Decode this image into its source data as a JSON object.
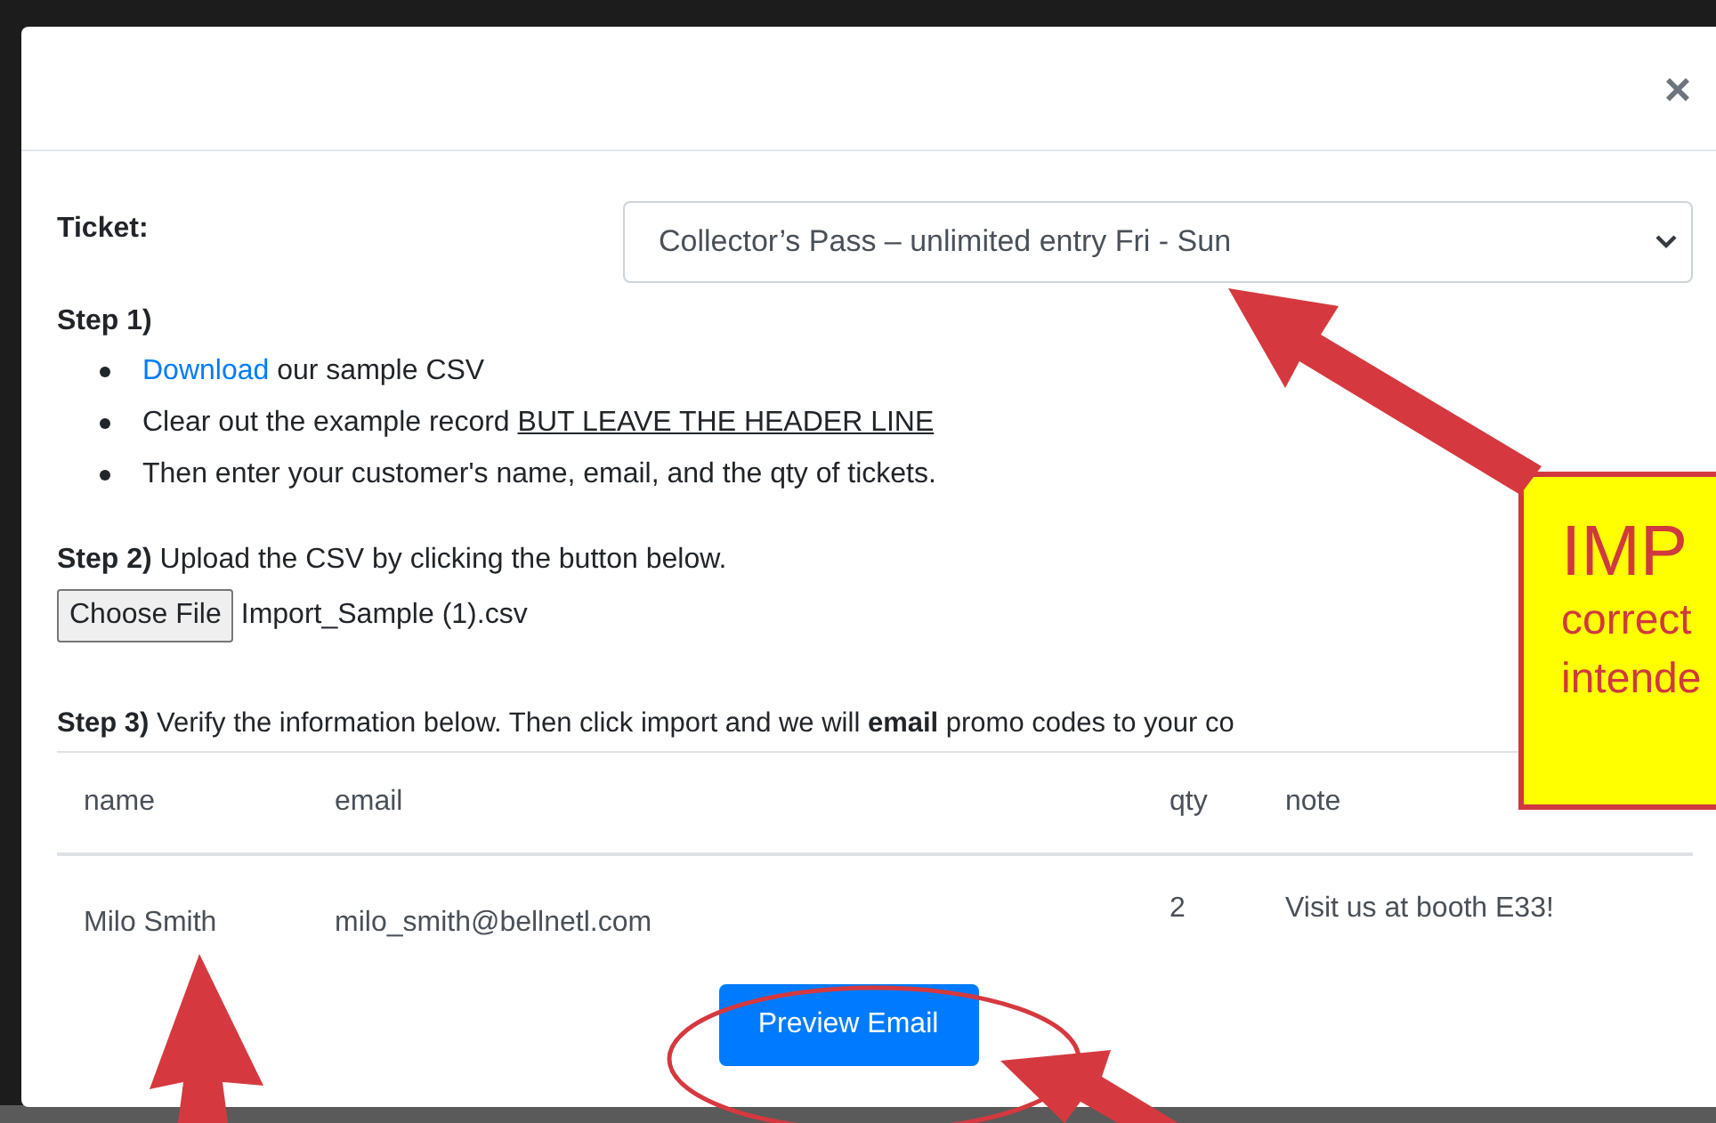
{
  "modal": {
    "close": "×",
    "ticket": {
      "label": "Ticket:",
      "value": "Collector’s Pass – unlimited entry Fri - Sun"
    },
    "step1": {
      "title": "Step 1)",
      "bullets": [
        [
          {
            "kind": "link",
            "text": "Download"
          },
          {
            "kind": "plain",
            "text": " our sample CSV"
          }
        ],
        [
          {
            "kind": "plain",
            "text": "Clear out the example record "
          },
          {
            "kind": "underline",
            "text": "BUT LEAVE THE HEADER LINE"
          }
        ],
        [
          {
            "kind": "plain",
            "text": "Then enter your customer's name, email, and the qty of tickets."
          }
        ]
      ]
    },
    "step2": {
      "text": "**Step 2)** Upload the CSV by clicking the button below.",
      "file_button": "Choose File",
      "file_name": "Import_Sample (1).csv"
    },
    "step3": {
      "text": "**Step 3)** Verify the information below. Then click import and we will **email** promo codes to your co"
    },
    "table": {
      "columns": [
        "name",
        "email",
        "qty",
        "note"
      ],
      "rows": [
        [
          "Milo Smith",
          "milo_smith@bellnetl.com",
          "2",
          "Visit us at booth E33!"
        ]
      ]
    },
    "button": "Preview Email"
  },
  "callout": {
    "heading": "IMP",
    "lines": [
      "correct",
      "intende"
    ]
  }
}
